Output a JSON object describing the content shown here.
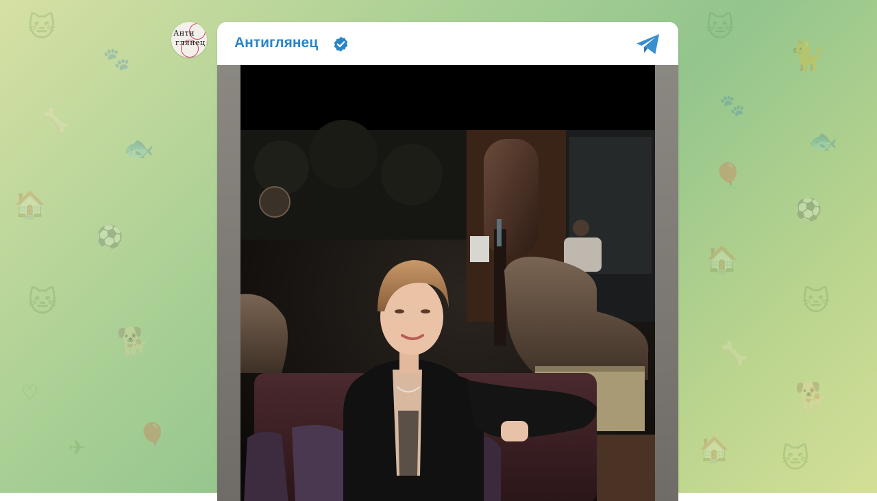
{
  "channel": {
    "name": "Антиглянец",
    "verified": true,
    "avatar_text_line1": "Анти",
    "avatar_text_line2": "глянец"
  },
  "icons": {
    "verified": "verified-badge-icon",
    "app": "telegram-plane-icon"
  },
  "colors": {
    "channel_name": "#2a85c4",
    "verified_badge": "#2a85c4",
    "telegram_icon": "#3a8fd0",
    "background_start": "#d6e0a4",
    "background_end": "#93c58d"
  },
  "media": {
    "type": "photo"
  }
}
